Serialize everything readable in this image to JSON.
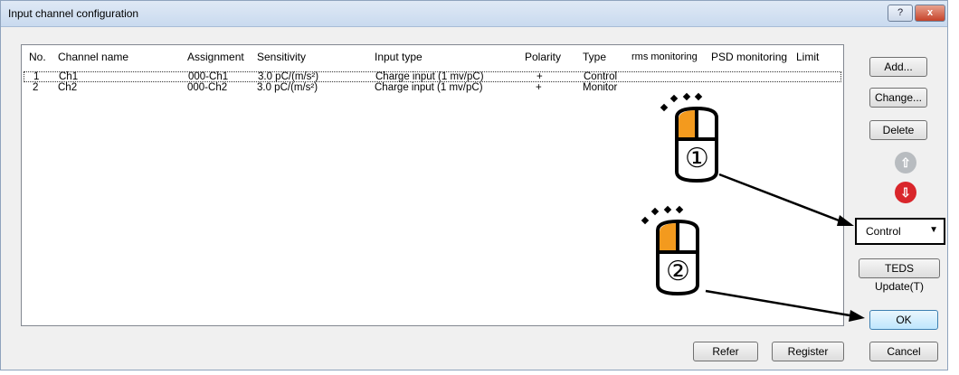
{
  "window": {
    "title": "Input channel configuration",
    "help_label": "?",
    "close_label": "x"
  },
  "table": {
    "columns": [
      "No.",
      "Channel name",
      "Assignment",
      "Sensitivity",
      "Input type",
      "Polarity",
      "Type",
      "rms monitoring",
      "PSD monitoring",
      "Limit"
    ],
    "rows": [
      [
        "1",
        "Ch1",
        "000-Ch1",
        "3.0 pC/(m/s²)",
        "Charge input (1 mv/pC)",
        "+",
        "Control",
        "",
        "",
        ""
      ],
      [
        "2",
        "Ch2",
        "000-Ch2",
        "3.0 pC/(m/s²)",
        "Charge input (1 mv/pC)",
        "+",
        "Monitor",
        "",
        "",
        ""
      ]
    ]
  },
  "buttons": {
    "add": "Add...",
    "change": "Change...",
    "delete": "Delete",
    "teds_update": "TEDS Update(T)",
    "ok": "OK",
    "cancel": "Cancel",
    "refer": "Refer",
    "register": "Register"
  },
  "icons": {
    "up": "arrow-up-icon",
    "down": "arrow-down-icon",
    "mouse": "mouse-left-click-icon"
  },
  "type_combo": {
    "value": "Control"
  },
  "annotations": {
    "step1": "①",
    "step2": "②"
  },
  "colors": {
    "accent_orange": "#f39a1e",
    "down_red": "#d9262b",
    "up_gray": "#b8bcc0"
  }
}
